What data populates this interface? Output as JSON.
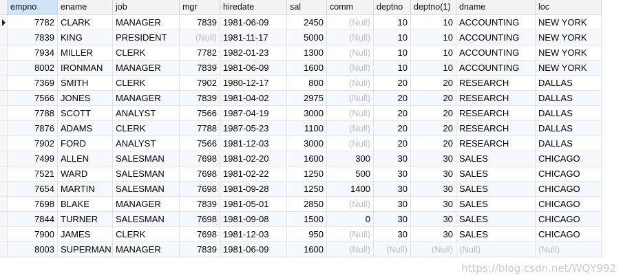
{
  "columns": [
    "empno",
    "ename",
    "job",
    "mgr",
    "hiredate",
    "sal",
    "comm",
    "deptno",
    "deptno(1)",
    "dname",
    "loc"
  ],
  "null_label": "(Null)",
  "rows": [
    [
      "7782",
      "CLARK",
      "MANAGER",
      "7839",
      "1981-06-09",
      "2450",
      null,
      "10",
      "10",
      "ACCOUNTING",
      "NEW YORK"
    ],
    [
      "7839",
      "KING",
      "PRESIDENT",
      null,
      "1981-11-17",
      "5000",
      null,
      "10",
      "10",
      "ACCOUNTING",
      "NEW YORK"
    ],
    [
      "7934",
      "MILLER",
      "CLERK",
      "7782",
      "1982-01-23",
      "1300",
      null,
      "10",
      "10",
      "ACCOUNTING",
      "NEW YORK"
    ],
    [
      "8002",
      "IRONMAN",
      "MANAGER",
      "7839",
      "1981-06-09",
      "1600",
      null,
      "10",
      "10",
      "ACCOUNTING",
      "NEW YORK"
    ],
    [
      "7369",
      "SMITH",
      "CLERK",
      "7902",
      "1980-12-17",
      "800",
      null,
      "20",
      "20",
      "RESEARCH",
      "DALLAS"
    ],
    [
      "7566",
      "JONES",
      "MANAGER",
      "7839",
      "1981-04-02",
      "2975",
      null,
      "20",
      "20",
      "RESEARCH",
      "DALLAS"
    ],
    [
      "7788",
      "SCOTT",
      "ANALYST",
      "7566",
      "1987-04-19",
      "3000",
      null,
      "20",
      "20",
      "RESEARCH",
      "DALLAS"
    ],
    [
      "7876",
      "ADAMS",
      "CLERK",
      "7788",
      "1987-05-23",
      "1100",
      null,
      "20",
      "20",
      "RESEARCH",
      "DALLAS"
    ],
    [
      "7902",
      "FORD",
      "ANALYST",
      "7566",
      "1981-12-03",
      "3000",
      null,
      "20",
      "20",
      "RESEARCH",
      "DALLAS"
    ],
    [
      "7499",
      "ALLEN",
      "SALESMAN",
      "7698",
      "1981-02-20",
      "1600",
      "300",
      "30",
      "30",
      "SALES",
      "CHICAGO"
    ],
    [
      "7521",
      "WARD",
      "SALESMAN",
      "7698",
      "1981-02-22",
      "1250",
      "500",
      "30",
      "30",
      "SALES",
      "CHICAGO"
    ],
    [
      "7654",
      "MARTIN",
      "SALESMAN",
      "7698",
      "1981-09-28",
      "1250",
      "1400",
      "30",
      "30",
      "SALES",
      "CHICAGO"
    ],
    [
      "7698",
      "BLAKE",
      "MANAGER",
      "7839",
      "1981-05-01",
      "2850",
      null,
      "30",
      "30",
      "SALES",
      "CHICAGO"
    ],
    [
      "7844",
      "TURNER",
      "SALESMAN",
      "7698",
      "1981-09-08",
      "1500",
      "0",
      "30",
      "30",
      "SALES",
      "CHICAGO"
    ],
    [
      "7900",
      "JAMES",
      "CLERK",
      "7698",
      "1981-12-03",
      "950",
      null,
      "30",
      "30",
      "SALES",
      "CHICAGO"
    ],
    [
      "8003",
      "SUPERMAN",
      "MANAGER",
      "7839",
      "1981-06-09",
      "1600",
      null,
      null,
      null,
      null,
      null
    ]
  ],
  "numeric_columns": [
    0,
    3,
    5,
    6,
    7,
    8
  ],
  "selected_row": 0,
  "watermark": "https://blog.csdn.net/WQY992"
}
